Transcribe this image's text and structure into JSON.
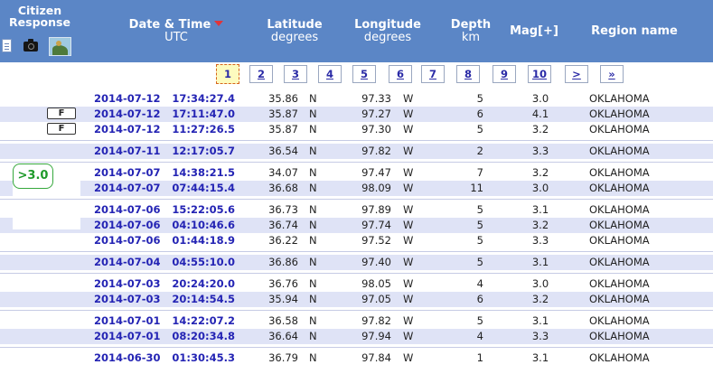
{
  "header": {
    "citizen_response": [
      "Citizen",
      "Response"
    ],
    "datetime": {
      "title": "Date & Time",
      "sub": "UTC"
    },
    "latitude": {
      "title": "Latitude",
      "sub": "degrees"
    },
    "longitude": {
      "title": "Longitude",
      "sub": "degrees"
    },
    "depth": {
      "title": "Depth",
      "sub": "km"
    },
    "magnitude": "Mag[+]",
    "region": "Region name",
    "icons": [
      "document-icon",
      "camera-icon",
      "photo-icon"
    ]
  },
  "pagination": {
    "pages": [
      "1",
      "2",
      "3",
      "4",
      "5",
      "6",
      "7",
      "8",
      "9",
      "10"
    ],
    "current": "1",
    "next": ">",
    "last": "»"
  },
  "filter_badge": ">3.0",
  "events": [
    {
      "date": "2014-07-12",
      "time": "17:34:27.4",
      "lat": "35.86",
      "ns": "N",
      "lon": "97.33",
      "ew": "W",
      "depth": "5",
      "mag": "3.0",
      "region": "OKLAHOMA",
      "felt": ""
    },
    {
      "date": "2014-07-12",
      "time": "17:11:47.0",
      "lat": "35.87",
      "ns": "N",
      "lon": "97.27",
      "ew": "W",
      "depth": "6",
      "mag": "4.1",
      "region": "OKLAHOMA",
      "felt": "F"
    },
    {
      "date": "2014-07-12",
      "time": "11:27:26.5",
      "lat": "35.87",
      "ns": "N",
      "lon": "97.30",
      "ew": "W",
      "depth": "5",
      "mag": "3.2",
      "region": "OKLAHOMA",
      "felt": "F"
    },
    {
      "date": "2014-07-11",
      "time": "12:17:05.7",
      "lat": "36.54",
      "ns": "N",
      "lon": "97.82",
      "ew": "W",
      "depth": "2",
      "mag": "3.3",
      "region": "OKLAHOMA",
      "felt": ""
    },
    {
      "date": "2014-07-07",
      "time": "14:38:21.5",
      "lat": "34.07",
      "ns": "N",
      "lon": "97.47",
      "ew": "W",
      "depth": "7",
      "mag": "3.2",
      "region": "OKLAHOMA",
      "felt": ""
    },
    {
      "date": "2014-07-07",
      "time": "07:44:15.4",
      "lat": "36.68",
      "ns": "N",
      "lon": "98.09",
      "ew": "W",
      "depth": "11",
      "mag": "3.0",
      "region": "OKLAHOMA",
      "felt": ""
    },
    {
      "date": "2014-07-06",
      "time": "15:22:05.6",
      "lat": "36.73",
      "ns": "N",
      "lon": "97.89",
      "ew": "W",
      "depth": "5",
      "mag": "3.1",
      "region": "OKLAHOMA",
      "felt": ""
    },
    {
      "date": "2014-07-06",
      "time": "04:10:46.6",
      "lat": "36.74",
      "ns": "N",
      "lon": "97.74",
      "ew": "W",
      "depth": "5",
      "mag": "3.2",
      "region": "OKLAHOMA",
      "felt": ""
    },
    {
      "date": "2014-07-06",
      "time": "01:44:18.9",
      "lat": "36.22",
      "ns": "N",
      "lon": "97.52",
      "ew": "W",
      "depth": "5",
      "mag": "3.3",
      "region": "OKLAHOMA",
      "felt": ""
    },
    {
      "date": "2014-07-04",
      "time": "04:55:10.0",
      "lat": "36.86",
      "ns": "N",
      "lon": "97.40",
      "ew": "W",
      "depth": "5",
      "mag": "3.1",
      "region": "OKLAHOMA",
      "felt": ""
    },
    {
      "date": "2014-07-03",
      "time": "20:24:20.0",
      "lat": "36.76",
      "ns": "N",
      "lon": "98.05",
      "ew": "W",
      "depth": "4",
      "mag": "3.0",
      "region": "OKLAHOMA",
      "felt": ""
    },
    {
      "date": "2014-07-03",
      "time": "20:14:54.5",
      "lat": "35.94",
      "ns": "N",
      "lon": "97.05",
      "ew": "W",
      "depth": "6",
      "mag": "3.2",
      "region": "OKLAHOMA",
      "felt": ""
    },
    {
      "date": "2014-07-01",
      "time": "14:22:07.2",
      "lat": "36.58",
      "ns": "N",
      "lon": "97.82",
      "ew": "W",
      "depth": "5",
      "mag": "3.1",
      "region": "OKLAHOMA",
      "felt": ""
    },
    {
      "date": "2014-07-01",
      "time": "08:20:34.8",
      "lat": "36.64",
      "ns": "N",
      "lon": "97.94",
      "ew": "W",
      "depth": "4",
      "mag": "3.3",
      "region": "OKLAHOMA",
      "felt": ""
    },
    {
      "date": "2014-06-30",
      "time": "01:30:45.3",
      "lat": "36.79",
      "ns": "N",
      "lon": "97.84",
      "ew": "W",
      "depth": "1",
      "mag": "3.1",
      "region": "OKLAHOMA",
      "felt": ""
    }
  ]
}
